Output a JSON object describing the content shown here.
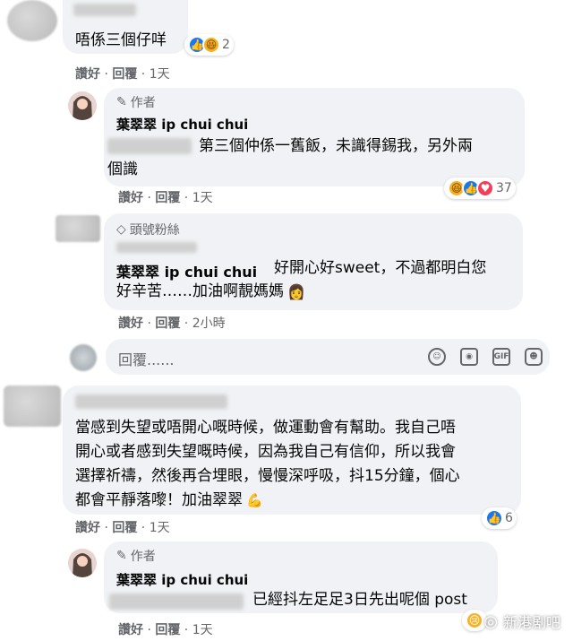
{
  "comment1": {
    "text": "唔係三個仔咩",
    "reaction_count": "2",
    "actions": {
      "like": "讚好",
      "reply": "回覆",
      "time": "1天"
    }
  },
  "reply1": {
    "author_tag": "作者",
    "name": "葉翠翠 ip chui chui",
    "text_line1": "第三個仲係一舊飯，未識得錫我，另外兩",
    "text_line2": "個識",
    "reaction_count": "37",
    "actions": {
      "like": "讚好",
      "reply": "回覆",
      "time": "1天"
    }
  },
  "reply2": {
    "fan_tag": "頭號粉絲",
    "name_mention": "葉翠翠 ip chui chui",
    "text_line1": "好開心好sweet，不過都明白您",
    "text_line2": "好辛苦……加油啊靚媽媽",
    "actions": {
      "like": "讚好",
      "reply": "回覆",
      "time": "2小時"
    }
  },
  "reply_box": {
    "placeholder": "回覆......"
  },
  "comment2": {
    "text_line1": "當感到失望或唔開心嘅時候，做運動會有幫助。我自己唔",
    "text_line2": "開心或者感到失望嘅時候，因為我自己有信仰，所以我會",
    "text_line3": "選擇祈禱，然後再合埋眼，慢慢深呼吸，抖15分鐘，個心",
    "text_line4": "都會平靜落嚟！加油翠翠",
    "reaction_count": "6",
    "actions": {
      "like": "讚好",
      "reply": "回覆",
      "time": "1天"
    }
  },
  "reply3": {
    "author_tag": "作者",
    "name": "葉翠翠 ip chui chui",
    "text": "已經抖左足足3日先出呢個 post",
    "actions": {
      "like": "讚好",
      "reply": "回覆",
      "time": "1天"
    }
  },
  "watermark": {
    "text": "新港剧吧"
  },
  "colors": {
    "bubble": "#f0f2f5",
    "secondary_text": "#65676b",
    "like_blue": "#1877f2"
  }
}
